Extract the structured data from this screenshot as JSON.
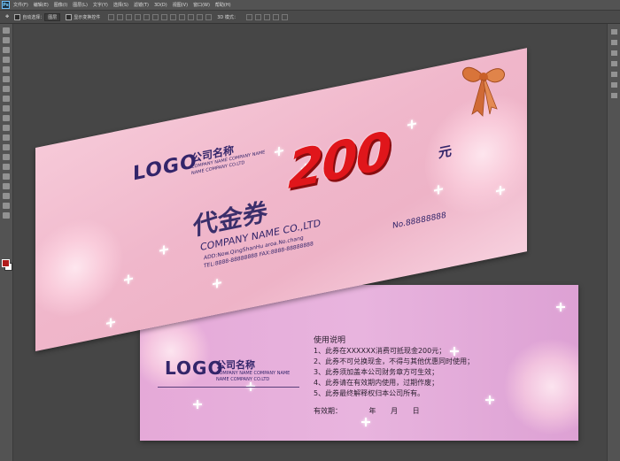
{
  "app": {
    "logo": "Ps",
    "menu": [
      "文件(F)",
      "编辑(E)",
      "图像(I)",
      "图层(L)",
      "文字(Y)",
      "选择(S)",
      "滤镜(T)",
      "3D(D)",
      "视图(V)",
      "窗口(W)",
      "帮助(H)"
    ]
  },
  "options": {
    "auto_select_label": "自动选择：",
    "auto_select_value": "图层",
    "show_transform_label": "显示变换控件",
    "mode_label": "3D 模式："
  },
  "ticket_front": {
    "logo": "LOGO",
    "company_cn": "公司名称",
    "company_en_1": "COMPANY NAME COMPANY NAME",
    "company_en_2": "NAME COMPANY CO.LTD",
    "amount": "200",
    "unit": "元",
    "voucher": "代金券",
    "company_line": "COMPANY NAME CO.,LTD",
    "address": "ADD:Now.QingShanHu aroa.No.chang",
    "tel": "TEL:8888-88888888   FAX:8888-88888888",
    "serial": "No.88888888"
  },
  "ticket_back": {
    "logo": "LOGO",
    "company_cn": "公司名称",
    "company_en_1": "COMPANY NAME COMPANY NAME",
    "company_en_2": "NAME COMPANY CO.LTD",
    "usage_title": "使用说明",
    "rules": [
      "1、此券在XXXXXX消费可抵现金200元；",
      "2、此券不可兑换现金，不得与其他优惠同时使用；",
      "3、此券须加盖本公司财务章方可生效；",
      "4、此券请在有效期内使用，过期作废；",
      "5、此券最终解释权归本公司所有。"
    ],
    "validity_label": "有效期：",
    "year": "年",
    "month": "月",
    "day": "日"
  },
  "colors": {
    "pink": "#f0b7cb",
    "violet": "#e5a9d8",
    "red": "#e0161b",
    "navy": "#33256a"
  }
}
